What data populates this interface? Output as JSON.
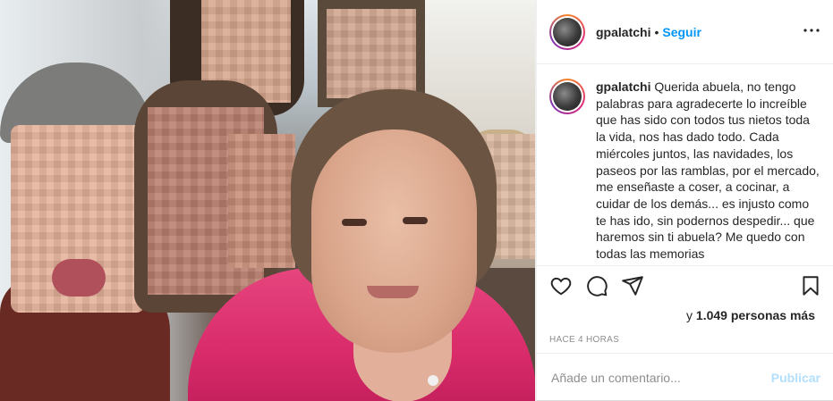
{
  "post": {
    "username": "gpalatchi",
    "separator": "•",
    "follow_label": "Seguir",
    "more_label": "•••",
    "caption": {
      "username": "gpalatchi",
      "text": "Querida abuela, no tengo palabras para agradecerte lo increíble que has sido con todos tus nietos toda la vida, nos has dado todo. Cada miércoles juntos, las navidades, los paseos por las ramblas, por el mercado, me enseñaste a coser, a cocinar, a cuidar de los demás... es injusto como te has ido, sin podernos despedir... que haremos sin ti abuela? Me quedo con todas las memorias"
    },
    "likes": {
      "prefix": "y ",
      "count_text": "1.049 personas más"
    },
    "timestamp": "HACE 4 HORAS",
    "comment": {
      "placeholder": "Añade un comentario...",
      "publish_label": "Publicar"
    },
    "icons": {
      "like": "heart-icon",
      "comment": "comment-icon",
      "share": "share-icon",
      "save": "bookmark-icon",
      "more": "more-options-icon"
    },
    "colors": {
      "link_blue": "#0095f6",
      "publish_disabled": "#b2dffc",
      "text": "#262626",
      "muted": "#8e8e8e",
      "dress_pink": "#d92b6a"
    }
  }
}
